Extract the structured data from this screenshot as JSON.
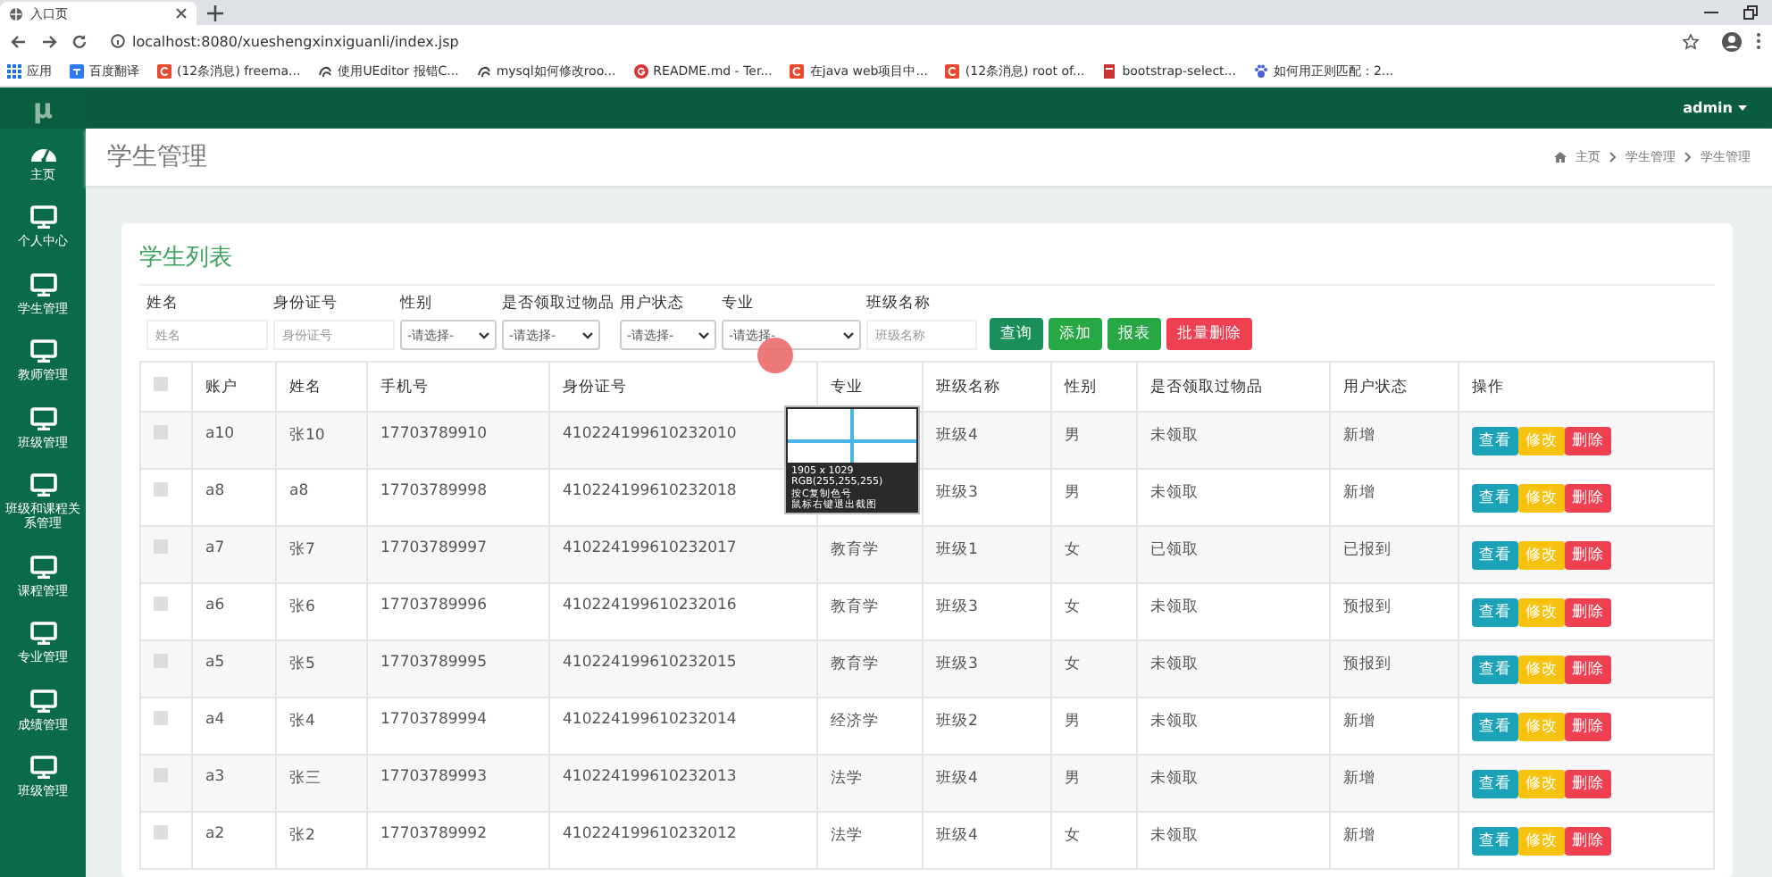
{
  "browser": {
    "tab_title": "入口页",
    "url": "localhost:8080/xueshengxinxiguanli/index.jsp",
    "bookmarks": [
      {
        "label": "应用",
        "kind": "apps"
      },
      {
        "label": "百度翻译",
        "kind": "translate"
      },
      {
        "label": "(12条消息) freema...",
        "kind": "csdn"
      },
      {
        "label": "使用UEditor 报错C...",
        "kind": "globe"
      },
      {
        "label": "mysql如何修改roo...",
        "kind": "globe"
      },
      {
        "label": "README.md - Ter...",
        "kind": "git"
      },
      {
        "label": "在java web项目中...",
        "kind": "csdn"
      },
      {
        "label": "(12条消息) root of...",
        "kind": "csdn"
      },
      {
        "label": "bootstrap-select...",
        "kind": "page"
      },
      {
        "label": "如何用正则匹配：2...",
        "kind": "paw"
      }
    ]
  },
  "sidebar": {
    "logo": "μ",
    "items": [
      {
        "label": "主页",
        "kind": "gauge"
      },
      {
        "label": "个人中心",
        "kind": "monitor"
      },
      {
        "label": "学生管理",
        "kind": "monitor"
      },
      {
        "label": "教师管理",
        "kind": "monitor"
      },
      {
        "label": "班级管理",
        "kind": "monitor"
      },
      {
        "label": "班级和课程关系管理",
        "kind": "monitor"
      },
      {
        "label": "课程管理",
        "kind": "monitor"
      },
      {
        "label": "专业管理",
        "kind": "monitor"
      },
      {
        "label": "成绩管理",
        "kind": "monitor"
      },
      {
        "label": "班级管理",
        "kind": "monitor"
      }
    ]
  },
  "topbar": {
    "user": "admin"
  },
  "page": {
    "title": "学生管理",
    "breadcrumb": [
      "主页",
      "学生管理",
      "学生管理"
    ]
  },
  "panel": {
    "title": "学生列表",
    "filters": [
      {
        "label": "姓名",
        "kind": "text",
        "placeholder": "姓名"
      },
      {
        "label": "身份证号",
        "kind": "text",
        "placeholder": "身份证号"
      },
      {
        "label": "性别",
        "kind": "select",
        "value": "-请选择-"
      },
      {
        "label": "是否领取过物品",
        "kind": "select",
        "value": "-请选择-"
      },
      {
        "label": "用户状态",
        "kind": "select",
        "value": "-请选择-"
      },
      {
        "label": "专业",
        "kind": "select",
        "value": "-请选择-"
      },
      {
        "label": "班级名称",
        "kind": "text",
        "placeholder": "班级名称"
      }
    ],
    "buttons": [
      {
        "label": "查询",
        "kind": "query"
      },
      {
        "label": "添加",
        "kind": "add"
      },
      {
        "label": "报表",
        "kind": "report"
      },
      {
        "label": "批量删除",
        "kind": "delete"
      }
    ]
  },
  "table": {
    "select_all": {
      "checked": false
    },
    "columns": [
      "账户",
      "姓名",
      "手机号",
      "身份证号",
      "专业",
      "班级名称",
      "性别",
      "是否领取过物品",
      "用户状态",
      "操作"
    ],
    "rows": [
      {
        "checked": false,
        "cells": [
          "a10",
          "张10",
          "17703789910",
          "410224199610232010",
          null,
          "班级4",
          "男",
          "未领取",
          "新增"
        ],
        "actions": [
          {
            "label": "查看",
            "kind": "view"
          },
          {
            "label": "修改",
            "kind": "edit"
          },
          {
            "label": "删除",
            "kind": "delete"
          }
        ]
      },
      {
        "checked": false,
        "cells": [
          "a8",
          "a8",
          "17703789998",
          "410224199610232018",
          null,
          "班级3",
          "男",
          "未领取",
          "新增"
        ],
        "actions": [
          {
            "label": "查看",
            "kind": "view"
          },
          {
            "label": "修改",
            "kind": "edit"
          },
          {
            "label": "删除",
            "kind": "delete"
          }
        ]
      },
      {
        "checked": false,
        "cells": [
          "a7",
          "张7",
          "17703789997",
          "410224199610232017",
          "教育学",
          "班级1",
          "女",
          "已领取",
          "已报到"
        ],
        "actions": [
          {
            "label": "查看",
            "kind": "view"
          },
          {
            "label": "修改",
            "kind": "edit"
          },
          {
            "label": "删除",
            "kind": "delete"
          }
        ]
      },
      {
        "checked": false,
        "cells": [
          "a6",
          "张6",
          "17703789996",
          "410224199610232016",
          "教育学",
          "班级3",
          "女",
          "未领取",
          "预报到"
        ],
        "actions": [
          {
            "label": "查看",
            "kind": "view"
          },
          {
            "label": "修改",
            "kind": "edit"
          },
          {
            "label": "删除",
            "kind": "delete"
          }
        ]
      },
      {
        "checked": false,
        "cells": [
          "a5",
          "张5",
          "17703789995",
          "410224199610232015",
          "教育学",
          "班级3",
          "女",
          "未领取",
          "预报到"
        ],
        "actions": [
          {
            "label": "查看",
            "kind": "view"
          },
          {
            "label": "修改",
            "kind": "edit"
          },
          {
            "label": "删除",
            "kind": "delete"
          }
        ]
      },
      {
        "checked": false,
        "cells": [
          "a4",
          "张4",
          "17703789994",
          "410224199610232014",
          "经济学",
          "班级2",
          "男",
          "未领取",
          "新增"
        ],
        "actions": [
          {
            "label": "查看",
            "kind": "view"
          },
          {
            "label": "修改",
            "kind": "edit"
          },
          {
            "label": "删除",
            "kind": "delete"
          }
        ]
      },
      {
        "checked": false,
        "cells": [
          "a3",
          "张三",
          "17703789993",
          "410224199610232013",
          "法学",
          "班级4",
          "男",
          "未领取",
          "新增"
        ],
        "actions": [
          {
            "label": "查看",
            "kind": "view"
          },
          {
            "label": "修改",
            "kind": "edit"
          },
          {
            "label": "删除",
            "kind": "delete"
          }
        ]
      },
      {
        "checked": false,
        "cells": [
          "a2",
          "张2",
          "17703789992",
          "410224199610232012",
          "法学",
          "班级4",
          "女",
          "未领取",
          "新增"
        ],
        "actions": [
          {
            "label": "查看",
            "kind": "view"
          },
          {
            "label": "修改",
            "kind": "edit"
          },
          {
            "label": "删除",
            "kind": "delete"
          }
        ]
      }
    ]
  },
  "color_picker": {
    "lines": [
      "1905 x 1029",
      "RGB(255,255,255)",
      "按C复制色号",
      "鼠标右键退出截图"
    ]
  }
}
